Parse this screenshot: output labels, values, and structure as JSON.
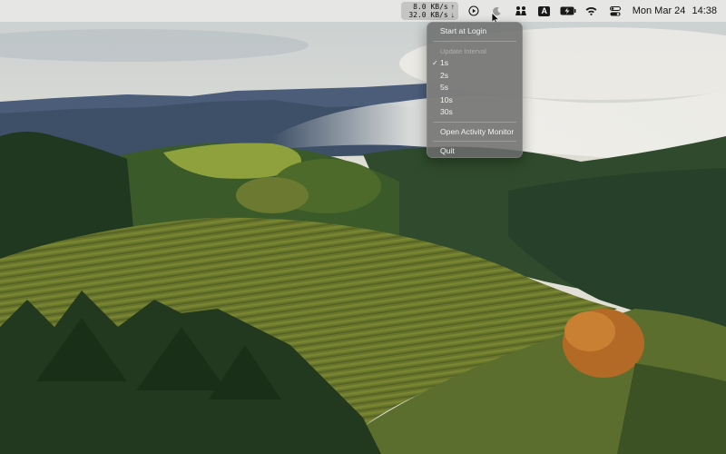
{
  "menubar": {
    "netspeed": {
      "upload": "8.0 KB/s",
      "download": "32.0 KB/s",
      "upload_arrow": "↑",
      "download_arrow": "↓"
    },
    "icons": [
      "play-circle-icon",
      "moon-icon",
      "people-icon",
      "input-source-icon",
      "battery-icon",
      "wifi-icon",
      "control-center-icon"
    ],
    "input_source_label": "A",
    "clock": {
      "date": "Mon Mar 24",
      "time": "14:38"
    }
  },
  "dropdown": {
    "start_at_login": "Start at Login",
    "interval_header": "Update Interval",
    "intervals": [
      "1s",
      "2s",
      "5s",
      "10s",
      "30s"
    ],
    "selected_interval": "1s",
    "check_mark": "✓",
    "open_activity_monitor": "Open Activity Monitor",
    "quit": "Quit"
  },
  "colors": {
    "menubar_bg": "#e8e8e6",
    "dropdown_bg": "#6c6c6c"
  }
}
